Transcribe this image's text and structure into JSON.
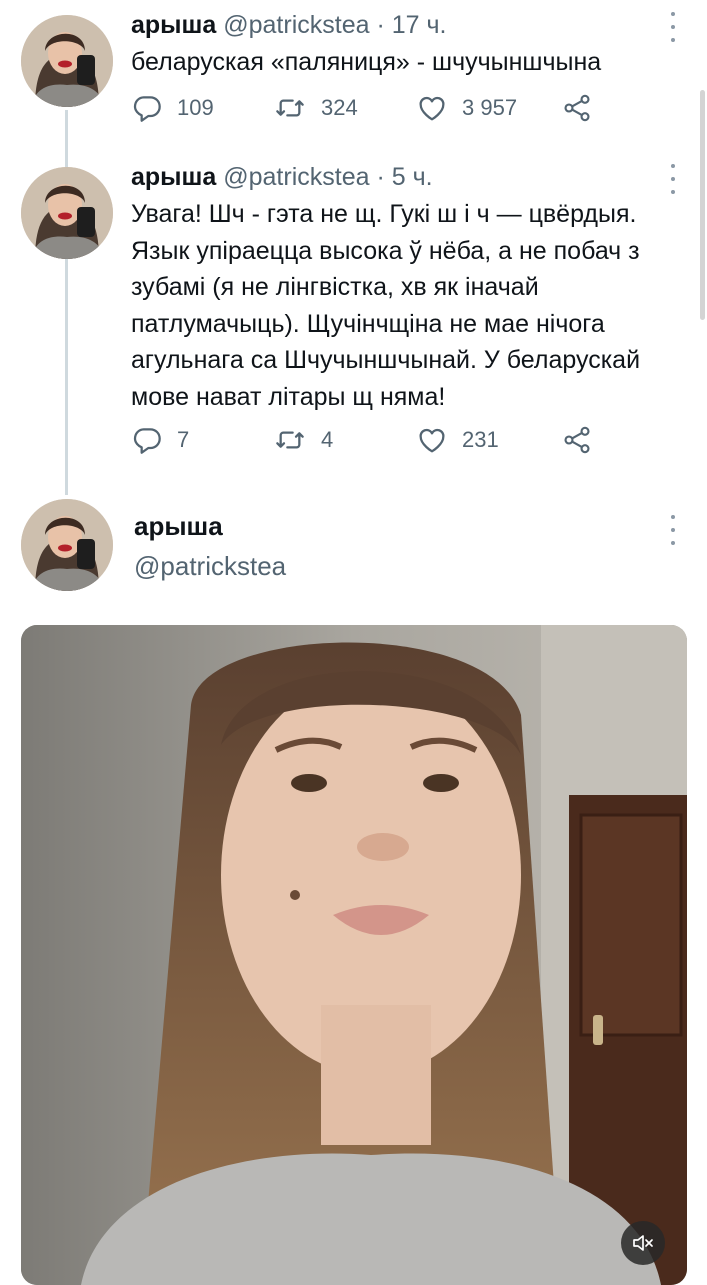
{
  "tweets": [
    {
      "name": "арыша",
      "handle": "@patrickstea",
      "separator": "·",
      "time": "17 ч.",
      "text": "беларуская «паляниця» - шчучыншчына",
      "replies": "109",
      "retweets": "324",
      "likes": "3 957"
    },
    {
      "name": "арыша",
      "handle": "@patrickstea",
      "separator": "·",
      "time": "5 ч.",
      "text": "Увага! Шч - гэта не щ. Гукі ш і ч — цвёрдыя. Язык упіраецца высока ў нёба, а не побач з зубамі (я не лінгвістка, хв як іначай патлумачыць). Щучінчщіна не мае нічога агульнага са Шчучыншчынай. У беларускай мове нават літары щ няма!",
      "replies": "7",
      "retweets": "4",
      "likes": "231"
    }
  ],
  "profile": {
    "name": "арыша",
    "handle": "@patrickstea"
  },
  "icons": {
    "reply": "reply-icon",
    "retweet": "retweet-icon",
    "like": "heart-icon",
    "share": "share-icon",
    "more": "more-vertical-icon",
    "mute": "muted-speaker-icon"
  },
  "colors": {
    "text": "#0f1419",
    "secondary": "#536471",
    "thread_line": "#cfd9de"
  }
}
